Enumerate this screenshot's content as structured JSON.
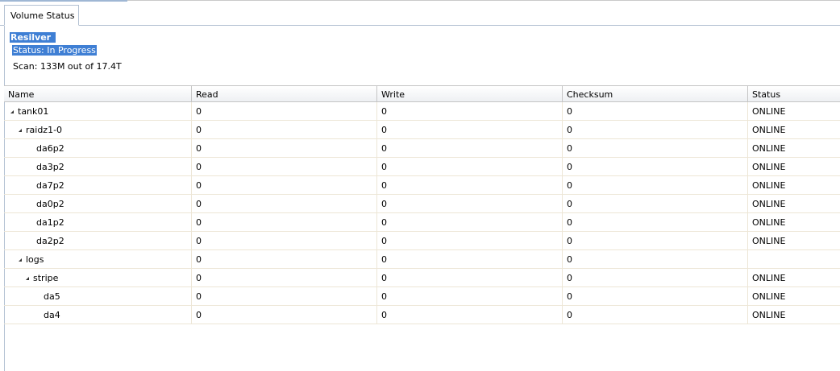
{
  "tab": {
    "label": "Volume Status"
  },
  "resilver": {
    "title": "Resilver",
    "status": "Status: In Progress",
    "scan": "Scan: 133M out of 17.4T"
  },
  "grid": {
    "columns": [
      "Name",
      "Read",
      "Write",
      "Checksum",
      "Status"
    ],
    "rows": [
      {
        "name": "tank01",
        "read": "0",
        "write": "0",
        "checksum": "0",
        "status": "ONLINE"
      },
      {
        "name": "raidz1-0",
        "read": "0",
        "write": "0",
        "checksum": "0",
        "status": "ONLINE"
      },
      {
        "name": "da6p2",
        "read": "0",
        "write": "0",
        "checksum": "0",
        "status": "ONLINE"
      },
      {
        "name": "da3p2",
        "read": "0",
        "write": "0",
        "checksum": "0",
        "status": "ONLINE"
      },
      {
        "name": "da7p2",
        "read": "0",
        "write": "0",
        "checksum": "0",
        "status": "ONLINE"
      },
      {
        "name": "da0p2",
        "read": "0",
        "write": "0",
        "checksum": "0",
        "status": "ONLINE"
      },
      {
        "name": "da1p2",
        "read": "0",
        "write": "0",
        "checksum": "0",
        "status": "ONLINE"
      },
      {
        "name": "da2p2",
        "read": "0",
        "write": "0",
        "checksum": "0",
        "status": "ONLINE"
      },
      {
        "name": "logs",
        "read": "0",
        "write": "0",
        "checksum": "0",
        "status": ""
      },
      {
        "name": "stripe",
        "read": "0",
        "write": "0",
        "checksum": "0",
        "status": "ONLINE"
      },
      {
        "name": "da5",
        "read": "0",
        "write": "0",
        "checksum": "0",
        "status": "ONLINE"
      },
      {
        "name": "da4",
        "read": "0",
        "write": "0",
        "checksum": "0",
        "status": "ONLINE"
      }
    ]
  },
  "colors": {
    "selection": "#3f7fd4",
    "row_border": "#ede6d6",
    "header_border": "#c5c5c5"
  }
}
